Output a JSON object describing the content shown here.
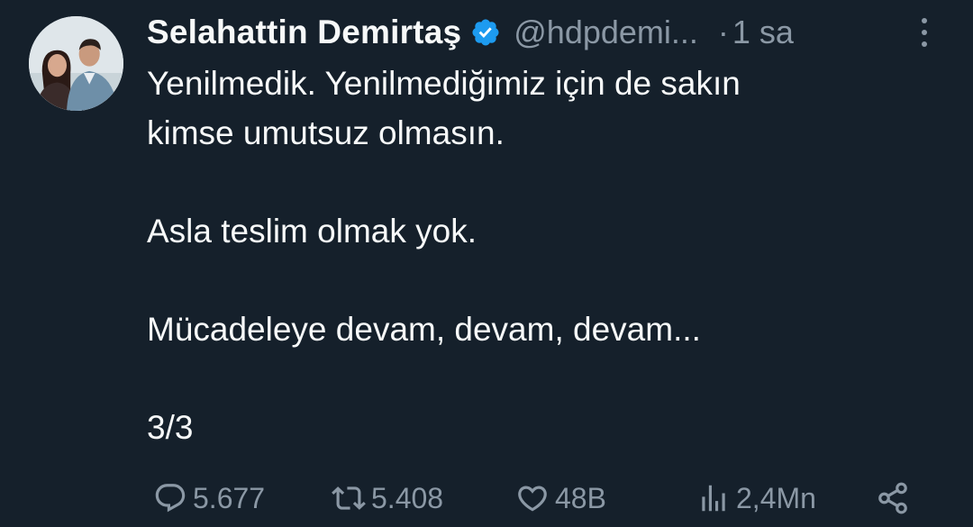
{
  "author": {
    "display_name": "Selahattin Demirtaş",
    "handle": "@hdpdemi...",
    "separator": "·",
    "time": "1 sa",
    "verified": true
  },
  "tweet": {
    "lines": [
      "Yenilmedik. Yenilmediğimiz için de sakın",
      "kimse umutsuz olmasın.",
      "Asla teslim olmak yok.",
      "Mücadeleye devam, devam, devam...",
      "3/3"
    ]
  },
  "actions": {
    "reply_count": "5.677",
    "retweet_count": "5.408",
    "like_count": "48B",
    "view_count": "2,4Mn"
  },
  "icons": {
    "verified": "verified-badge-icon",
    "more": "more-vertical-icon",
    "reply": "reply-icon",
    "retweet": "retweet-icon",
    "like": "heart-icon",
    "views": "analytics-icon",
    "share": "share-icon"
  },
  "colors": {
    "background": "#15202b",
    "text_primary": "#f7f9f9",
    "text_secondary": "#8b98a5",
    "verified_blue": "#1d9bf0"
  }
}
